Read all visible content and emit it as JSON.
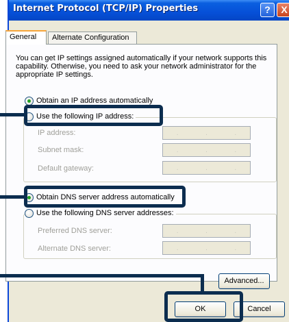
{
  "window": {
    "title": "Internet Protocol (TCP/IP) Properties",
    "help_glyph": "?",
    "close_glyph": "X"
  },
  "tabs": [
    {
      "label": "General",
      "selected": true
    },
    {
      "label": "Alternate Configuration",
      "selected": false
    }
  ],
  "description": "You can get IP settings assigned automatically if your network supports this capability. Otherwise, you need to ask your network administrator for the appropriate IP settings.",
  "ip_section": {
    "auto_label": "Obtain an IP address automatically",
    "auto_checked": true,
    "manual_label": "Use the following IP address:",
    "manual_checked": false,
    "fields": [
      {
        "label": "IP address:",
        "value": ""
      },
      {
        "label": "Subnet mask:",
        "value": ""
      },
      {
        "label": "Default gateway:",
        "value": ""
      }
    ]
  },
  "dns_section": {
    "auto_label": "Obtain DNS server address automatically",
    "auto_checked": true,
    "manual_label": "Use the following DNS server addresses:",
    "manual_checked": false,
    "fields": [
      {
        "label": "Preferred DNS server:",
        "value": ""
      },
      {
        "label": "Alternate DNS server:",
        "value": ""
      }
    ]
  },
  "ip_dots": [
    ".",
    ".",
    "."
  ],
  "buttons": {
    "advanced": "Advanced...",
    "ok": "OK",
    "cancel": "Cancel"
  }
}
